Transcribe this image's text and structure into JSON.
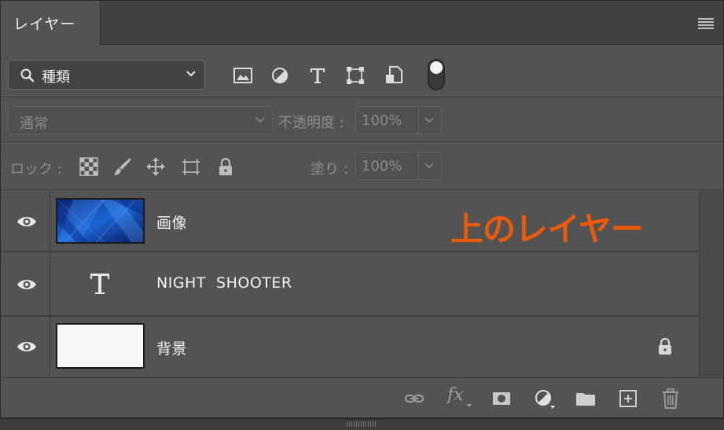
{
  "panel": {
    "tab_label": "レイヤー",
    "menu_icon": "panel-menu-icon"
  },
  "filter": {
    "kind_label": "種類",
    "icons": [
      "image-filter-icon",
      "adjustment-filter-icon",
      "type-filter-icon",
      "shape-filter-icon",
      "smart-object-filter-icon"
    ],
    "toggle_on": true
  },
  "blend": {
    "mode": "通常",
    "opacity_label": "不透明度 :",
    "opacity_value": "100%"
  },
  "lock": {
    "label": "ロック :",
    "icons": [
      "lock-transparent-pixels-icon",
      "lock-image-pixels-icon",
      "lock-position-icon",
      "lock-artboard-icon",
      "lock-all-icon"
    ],
    "fill_label": "塗り :",
    "fill_value": "100%"
  },
  "layers": [
    {
      "name": "画像",
      "kind": "image",
      "visible": true,
      "locked": false
    },
    {
      "name": "NIGHT  SHOOTER",
      "kind": "text",
      "visible": true,
      "locked": false
    },
    {
      "name": "背景",
      "kind": "background",
      "visible": true,
      "locked": true
    }
  ],
  "annotation": {
    "text": "上のレイヤー",
    "color": "#ea5a0c"
  },
  "bottom_bar": {
    "fx_label": "fx",
    "icons": [
      "link-layers-icon",
      "fx-icon",
      "layer-mask-icon",
      "adjustment-layer-icon",
      "group-folder-icon",
      "new-layer-icon",
      "trash-icon"
    ]
  }
}
